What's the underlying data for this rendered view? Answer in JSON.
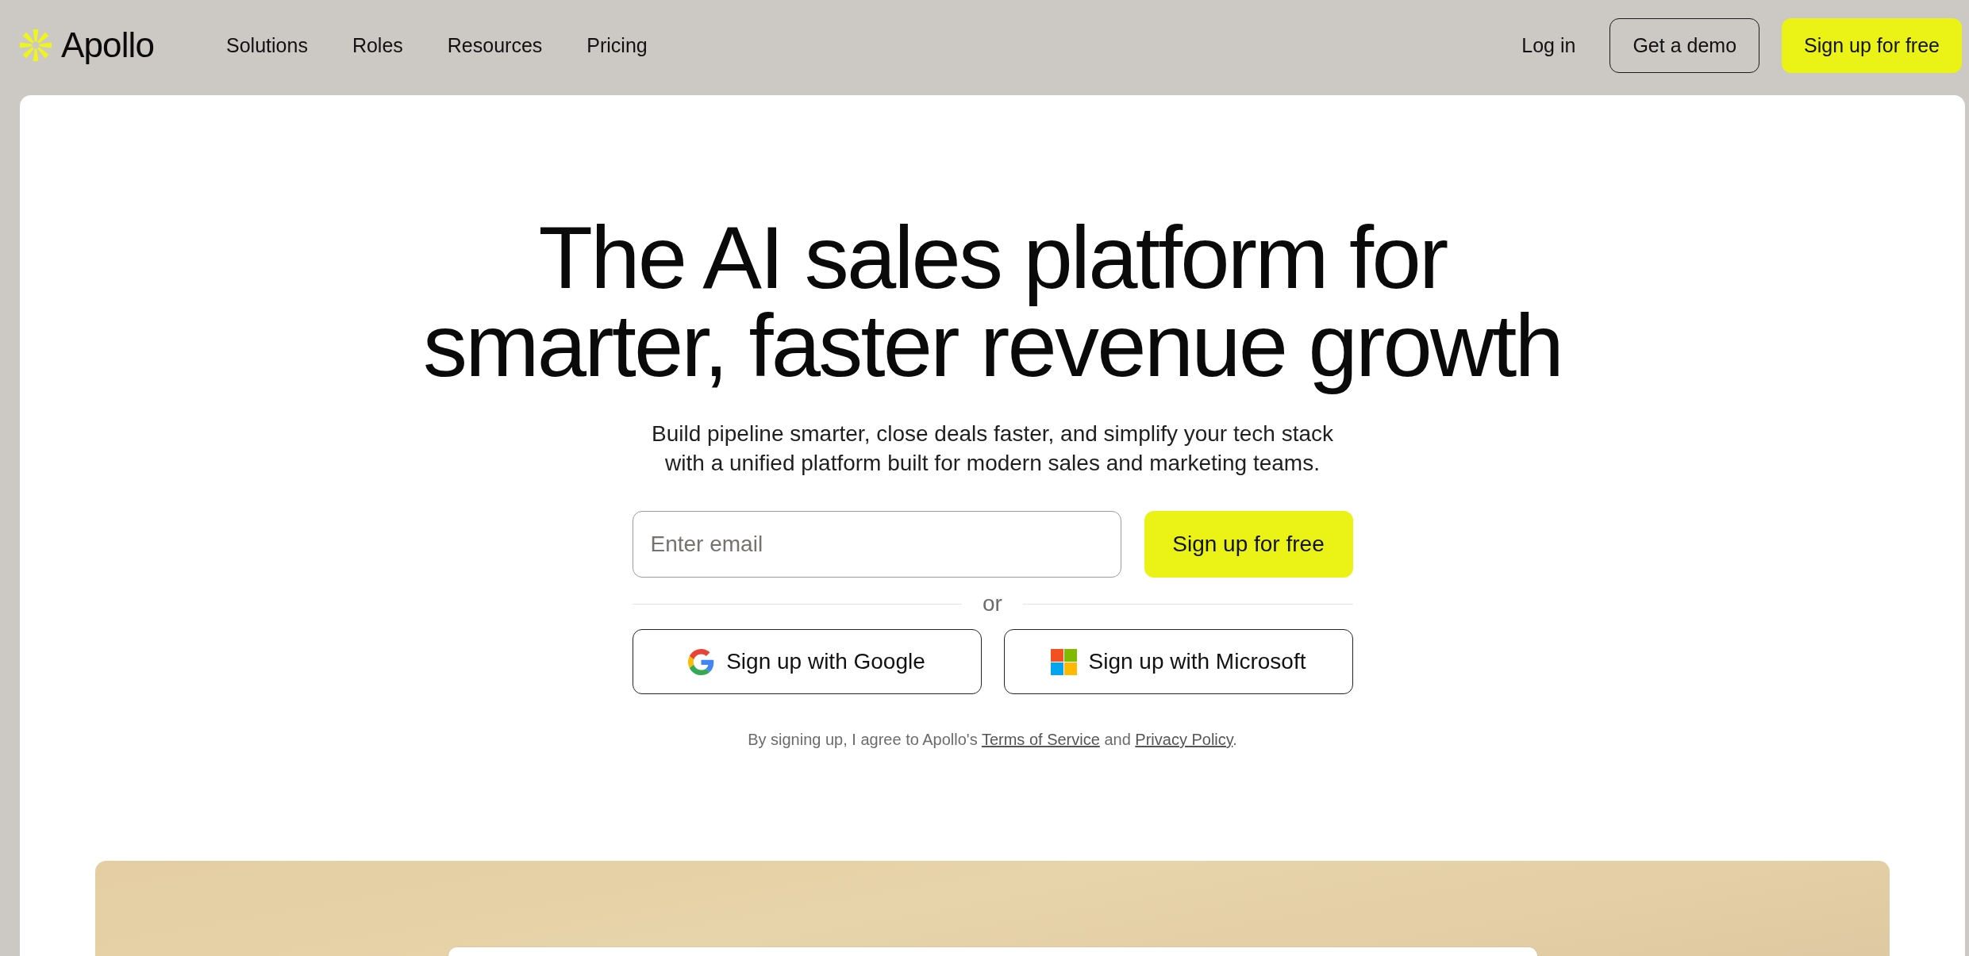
{
  "header": {
    "logo": {
      "text": "Apollo"
    },
    "nav_links": [
      {
        "label": "Solutions"
      },
      {
        "label": "Roles"
      },
      {
        "label": "Resources"
      },
      {
        "label": "Pricing"
      }
    ],
    "actions": [
      {
        "label": "Log in",
        "kind": "link"
      },
      {
        "label": "Get a demo",
        "kind": "outline"
      },
      {
        "label": "Sign up for free",
        "kind": "primary"
      }
    ]
  },
  "hero": {
    "title": "The AI sales platform for smarter, faster revenue growth",
    "subtitle": "Build pipeline smarter, close deals faster, and simplify your tech stack with a unified platform built for modern sales and marketing teams.",
    "email_field": {
      "placeholder": "Enter email"
    },
    "submit_button": {
      "label": "Sign up for free"
    },
    "divider": {
      "label": "or"
    },
    "social_buttons": [
      {
        "label": "Sign up with Google",
        "kind": "google"
      },
      {
        "label": "Sign up with Microsoft",
        "kind": "microsoft"
      }
    ],
    "terms": [
      {
        "kind": "text",
        "text": "By signing up, I agree to Apollo's "
      },
      {
        "kind": "link",
        "text": "Terms of Service"
      },
      {
        "kind": "text",
        "text": " and "
      },
      {
        "kind": "link",
        "text": "Privacy Policy"
      },
      {
        "kind": "text",
        "text": "."
      }
    ]
  }
}
